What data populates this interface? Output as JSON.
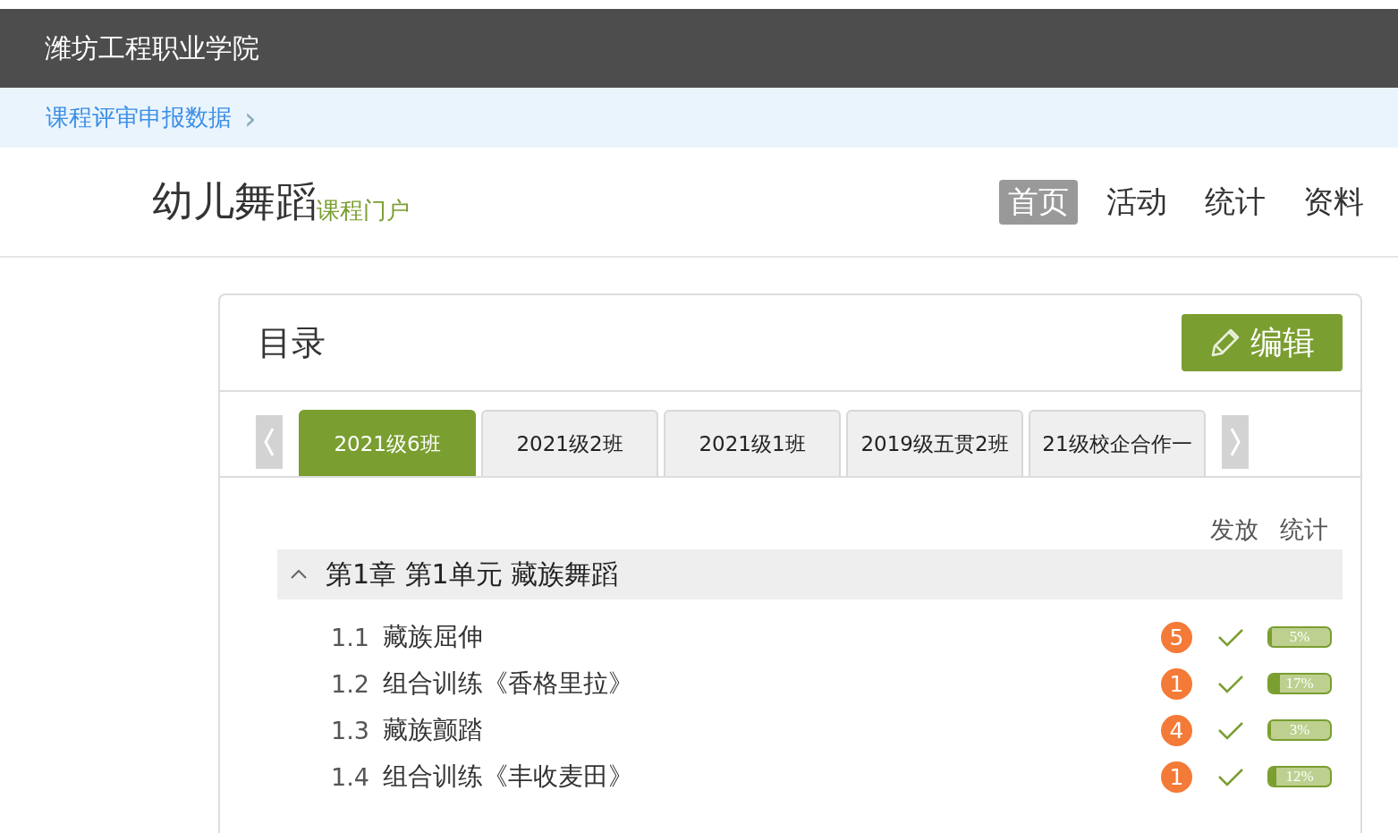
{
  "school": "潍坊工程职业学院",
  "breadcrumb": {
    "label": "课程评审申报数据",
    "arrow": "›"
  },
  "course": {
    "title": "幼儿舞蹈",
    "subtitle": "课程门户"
  },
  "nav": [
    {
      "label": "首页",
      "selected": true
    },
    {
      "label": "活动",
      "selected": false
    },
    {
      "label": "统计",
      "selected": false
    },
    {
      "label": "资料",
      "selected": false
    }
  ],
  "catalog": {
    "title": "目录",
    "edit_button": "编辑",
    "tabs": [
      {
        "label": "2021级6班",
        "selected": true
      },
      {
        "label": "2021级2班",
        "selected": false
      },
      {
        "label": "2021级1班",
        "selected": false
      },
      {
        "label": "2019级五贯2班",
        "selected": false
      },
      {
        "label": "21级校企合作一",
        "selected": false
      }
    ],
    "columns": [
      "发放",
      "统计"
    ],
    "chapters": [
      {
        "title": "第1章 第1单元 藏族舞蹈",
        "expanded": true,
        "lessons": [
          {
            "number": "1.1",
            "title": "藏族屈伸",
            "count": "5",
            "released": true,
            "level": 0.05,
            "reading": "5%"
          },
          {
            "number": "1.2",
            "title": "组合训练《香格里拉》",
            "count": "1",
            "released": true,
            "level": 0.17,
            "reading": "17%"
          },
          {
            "number": "1.3",
            "title": "藏族颤踏",
            "count": "4",
            "released": true,
            "level": 0.03,
            "reading": "3%"
          },
          {
            "number": "1.4",
            "title": "组合训练《丰收麦田》",
            "count": "1",
            "released": true,
            "level": 0.12,
            "reading": "12%"
          }
        ]
      }
    ]
  }
}
